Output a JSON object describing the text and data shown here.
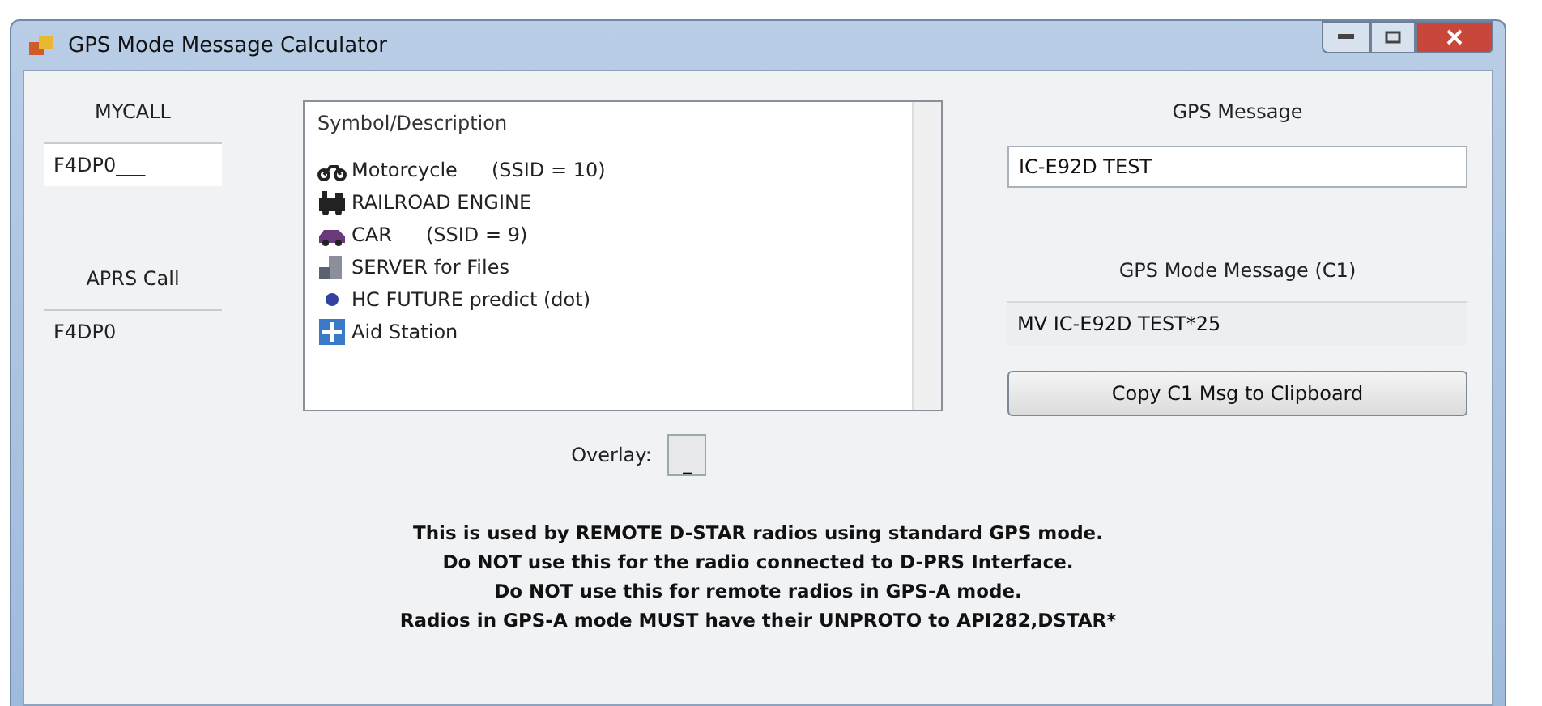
{
  "window": {
    "title": "GPS Mode Message Calculator"
  },
  "mycall": {
    "label": "MYCALL",
    "value": "F4DP0___"
  },
  "aprs_call": {
    "label": "APRS Call",
    "value": "F4DP0"
  },
  "symbol_list": {
    "header": "Symbol/Description",
    "items": [
      {
        "kind": "motorcycle",
        "label": "Motorcycle",
        "detail": "(SSID = 10)"
      },
      {
        "kind": "train",
        "label": "RAILROAD ENGINE"
      },
      {
        "kind": "car",
        "label": "CAR",
        "detail": "(SSID = 9)"
      },
      {
        "kind": "server",
        "label": "SERVER for Files"
      },
      {
        "kind": "dot",
        "label": "HC FUTURE predict (dot)"
      },
      {
        "kind": "aid",
        "label": "Aid Station"
      }
    ]
  },
  "overlay": {
    "label": "Overlay:",
    "value": "_"
  },
  "gps_message": {
    "label": "GPS Message",
    "value": "IC-E92D TEST"
  },
  "gps_mode_message": {
    "label": "GPS Mode Message (C1)",
    "value": "MV  IC-E92D TEST*25"
  },
  "copy_button": {
    "label": "Copy C1 Msg to Clipboard"
  },
  "notes": [
    "This is used by REMOTE D-STAR radios using standard GPS mode.",
    "Do NOT use this for the radio connected to D-PRS Interface.",
    "Do NOT use this for remote radios in GPS-A mode.",
    "Radios in GPS-A mode MUST have their UNPROTO to API282,DSTAR*"
  ]
}
